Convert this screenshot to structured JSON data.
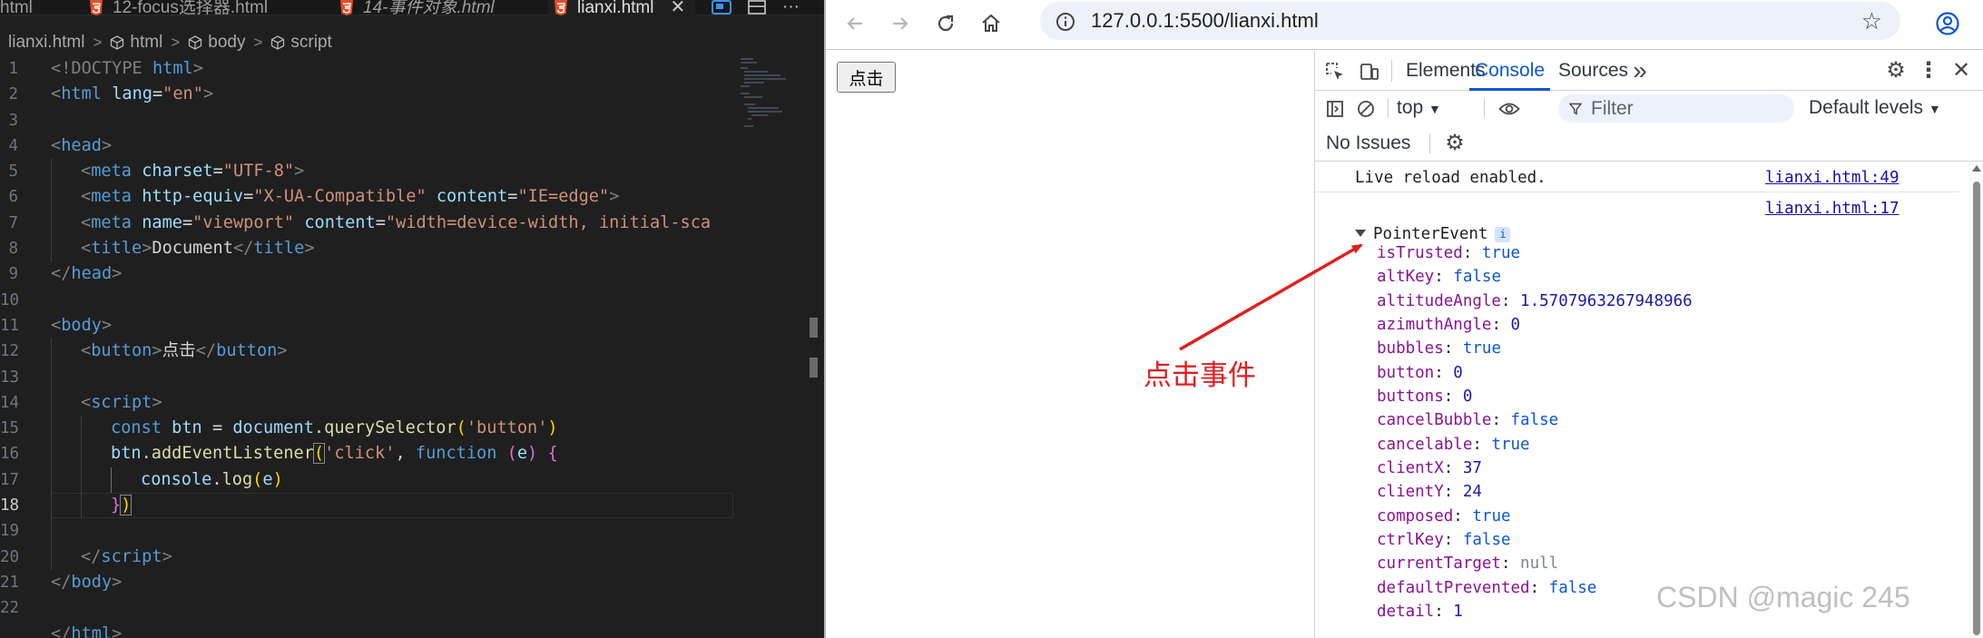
{
  "editor": {
    "tabs": [
      {
        "label": "html",
        "italic": false,
        "active": false
      },
      {
        "label": "12-focus选择器.html",
        "italic": false,
        "active": false
      },
      {
        "label": "14-事件对象.html",
        "italic": true,
        "active": false
      },
      {
        "label": "lianxi.html",
        "italic": false,
        "active": true
      }
    ],
    "close_glyph": "✕",
    "more_glyph": "···",
    "breadcrumb": [
      "lianxi.html",
      "html",
      "body",
      "script"
    ],
    "current_line": 18,
    "line_numbers": [
      "1",
      "2",
      "3",
      "4",
      "5",
      "6",
      "7",
      "8",
      "9",
      "10",
      "11",
      "12",
      "13",
      "14",
      "15",
      "16",
      "17",
      "18",
      "19",
      "20",
      "21",
      "22"
    ],
    "code": {
      "l1": [
        "<!DOCTYPE ",
        "html",
        ">"
      ],
      "l2": [
        "<",
        "html",
        " ",
        "lang",
        "=",
        "\"en\"",
        ">"
      ],
      "l4": [
        "<",
        "head",
        ">"
      ],
      "l5": [
        "<",
        "meta",
        " ",
        "charset",
        "=",
        "\"UTF-8\"",
        ">"
      ],
      "l6": [
        "<",
        "meta",
        " ",
        "http-equiv",
        "=",
        "\"X-UA-Compatible\"",
        " ",
        "content",
        "=",
        "\"IE=edge\"",
        ">"
      ],
      "l7": [
        "<",
        "meta",
        " ",
        "name",
        "=",
        "\"viewport\"",
        " ",
        "content",
        "=",
        "\"width=device-width, initial-sca"
      ],
      "l8": [
        "<",
        "title",
        ">",
        "Document",
        "</",
        "title",
        ">"
      ],
      "l9": [
        "</",
        "head",
        ">"
      ],
      "l11": [
        "<",
        "body",
        ">"
      ],
      "l12": [
        "<",
        "button",
        ">",
        "点击",
        "</",
        "button",
        ">"
      ],
      "l14": [
        "<",
        "script",
        ">"
      ],
      "l15": [
        "const ",
        "btn",
        " = ",
        "document",
        ".",
        "querySelector",
        "(",
        "'button'",
        ")"
      ],
      "l16": [
        "btn",
        ".",
        "addEventListener",
        "(",
        "'click'",
        ", ",
        "function",
        " (",
        "e",
        ") ",
        "{"
      ],
      "l17": [
        "console",
        ".",
        "log",
        "(",
        "e",
        ")"
      ],
      "l18": [
        "}",
        ")"
      ],
      "l20": [
        "</",
        "script",
        ">"
      ],
      "l21": [
        "</",
        "body",
        ">"
      ],
      "l23": [
        "</",
        "html",
        ">"
      ]
    }
  },
  "browser": {
    "url": "127.0.0.1:5500/lianxi.html",
    "page_button_label": "点击",
    "annotation": "点击事件"
  },
  "devtools": {
    "tabs": [
      "Elements",
      "Console",
      "Sources"
    ],
    "active_tab": "Console",
    "more_tabs_glyph": "»",
    "context": "top",
    "filter_placeholder": "Filter",
    "levels": "Default levels",
    "issues": "No Issues",
    "messages": [
      {
        "text": "Live reload enabled.",
        "source": "lianxi.html:49"
      },
      {
        "text": "",
        "source": "lianxi.html:17"
      }
    ],
    "object_name": "PointerEvent",
    "info_glyph": "i",
    "properties": [
      {
        "key": "isTrusted",
        "value": "true",
        "type": "bool"
      },
      {
        "key": "altKey",
        "value": "false",
        "type": "bool"
      },
      {
        "key": "altitudeAngle",
        "value": "1.5707963267948966",
        "type": "num"
      },
      {
        "key": "azimuthAngle",
        "value": "0",
        "type": "num"
      },
      {
        "key": "bubbles",
        "value": "true",
        "type": "bool"
      },
      {
        "key": "button",
        "value": "0",
        "type": "num"
      },
      {
        "key": "buttons",
        "value": "0",
        "type": "num"
      },
      {
        "key": "cancelBubble",
        "value": "false",
        "type": "bool"
      },
      {
        "key": "cancelable",
        "value": "true",
        "type": "bool"
      },
      {
        "key": "clientX",
        "value": "37",
        "type": "num"
      },
      {
        "key": "clientY",
        "value": "24",
        "type": "num"
      },
      {
        "key": "composed",
        "value": "true",
        "type": "bool"
      },
      {
        "key": "ctrlKey",
        "value": "false",
        "type": "bool"
      },
      {
        "key": "currentTarget",
        "value": "null",
        "type": "null"
      },
      {
        "key": "defaultPrevented",
        "value": "false",
        "type": "bool"
      },
      {
        "key": "detail",
        "value": "1",
        "type": "num"
      }
    ]
  },
  "watermark": "CSDN @magic 245",
  "colors": {
    "editor_bg": "#1f1f1f",
    "accent_blue": "#0b57d0",
    "annotation_red": "#e02020"
  }
}
